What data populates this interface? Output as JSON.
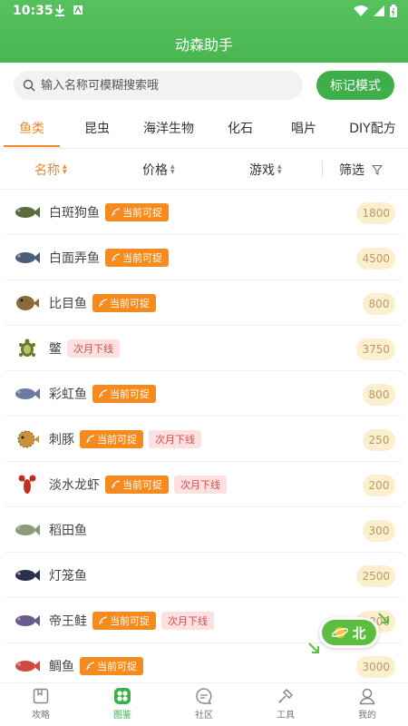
{
  "status_bar": {
    "time": "10:35"
  },
  "header": {
    "title": "动森助手"
  },
  "search": {
    "placeholder": "输入名称可模糊搜索哦",
    "mark_button": "标记模式"
  },
  "tabs": [
    "鱼类",
    "昆虫",
    "海洋生物",
    "化石",
    "唱片",
    "DIY配方"
  ],
  "sort": {
    "name": "名称",
    "price": "价格",
    "game": "游戏",
    "filter": "筛选"
  },
  "items": [
    {
      "name": "白斑狗鱼",
      "badges": [
        "当前可捉"
      ],
      "price": "1800",
      "icon": "pike-fish-icon",
      "color": "#5b6b3a"
    },
    {
      "name": "白面弄鱼",
      "badges": [
        "当前可捉"
      ],
      "price": "4500",
      "icon": "char-fish-icon",
      "color": "#4a5e7a"
    },
    {
      "name": "比目鱼",
      "badges": [
        "当前可捉"
      ],
      "price": "800",
      "icon": "flounder-icon",
      "color": "#8a6a3a"
    },
    {
      "name": "鳖",
      "badges": [
        "次月下线"
      ],
      "price": "3750",
      "icon": "turtle-icon",
      "color": "#6a7a2a"
    },
    {
      "name": "彩虹鱼",
      "badges": [
        "当前可捉"
      ],
      "price": "800",
      "icon": "rainbowfish-icon",
      "color": "#6a7aa0"
    },
    {
      "name": "刺豚",
      "badges": [
        "当前可捉",
        "次月下线"
      ],
      "price": "250",
      "icon": "puffer-icon",
      "color": "#c9913a"
    },
    {
      "name": "淡水龙虾",
      "badges": [
        "当前可捉",
        "次月下线"
      ],
      "price": "200",
      "icon": "crayfish-icon",
      "color": "#c03020"
    },
    {
      "name": "稻田鱼",
      "badges": [],
      "price": "300",
      "icon": "ricefish-icon",
      "color": "#8a9a7a"
    },
    {
      "name": "灯笼鱼",
      "badges": [],
      "price": "2500",
      "icon": "lanternfish-icon",
      "color": "#2a3050"
    },
    {
      "name": "帝王鲑",
      "badges": [
        "当前可捉",
        "次月下线"
      ],
      "price": "1800",
      "icon": "salmon-icon",
      "color": "#6a5a8a"
    },
    {
      "name": "鲷鱼",
      "badges": [
        "当前可捉"
      ],
      "price": "3000",
      "icon": "snapper-icon",
      "color": "#d04a40"
    }
  ],
  "floating": {
    "label": "北"
  },
  "bottom_nav": [
    "攻略",
    "图鉴",
    "社区",
    "工具",
    "我的"
  ]
}
